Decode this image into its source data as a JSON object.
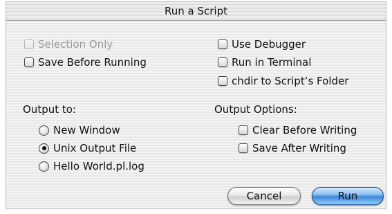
{
  "dialog": {
    "title": "Run a Script"
  },
  "options": {
    "selection_only": "Selection Only",
    "save_before_running": "Save Before Running",
    "use_debugger": "Use Debugger",
    "run_in_terminal": "Run in Terminal",
    "chdir_to_script_folder": "chdir to Script’s Folder"
  },
  "output_to": {
    "label": "Output to:",
    "choices": [
      "New Window",
      "Unix Output File",
      "Hello World.pl.log"
    ],
    "selected": "Unix Output File"
  },
  "output_options": {
    "label": "Output Options:",
    "clear_before_writing": "Clear Before Writing",
    "save_after_writing": "Save After Writing"
  },
  "buttons": {
    "cancel": "Cancel",
    "run": "Run"
  },
  "colors": {
    "default_button": "#3d86d6",
    "disabled_text": "#9a9a9a"
  }
}
